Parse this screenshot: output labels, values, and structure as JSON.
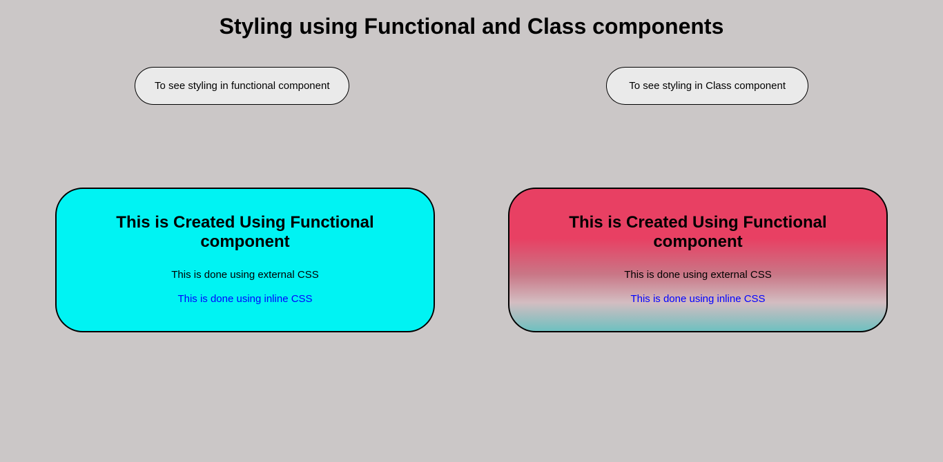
{
  "title": "Styling using Functional and Class components",
  "buttons": {
    "functional": "To see styling in functional component",
    "class": "To see styling in Class component"
  },
  "cards": {
    "left": {
      "title": "This is Created Using Functional component",
      "external_text": "This is done using external CSS",
      "inline_text": "This is done using inline CSS"
    },
    "right": {
      "title": "This is Created Using Functional component",
      "external_text": "This is done using external CSS",
      "inline_text": "This is done using inline CSS"
    }
  }
}
